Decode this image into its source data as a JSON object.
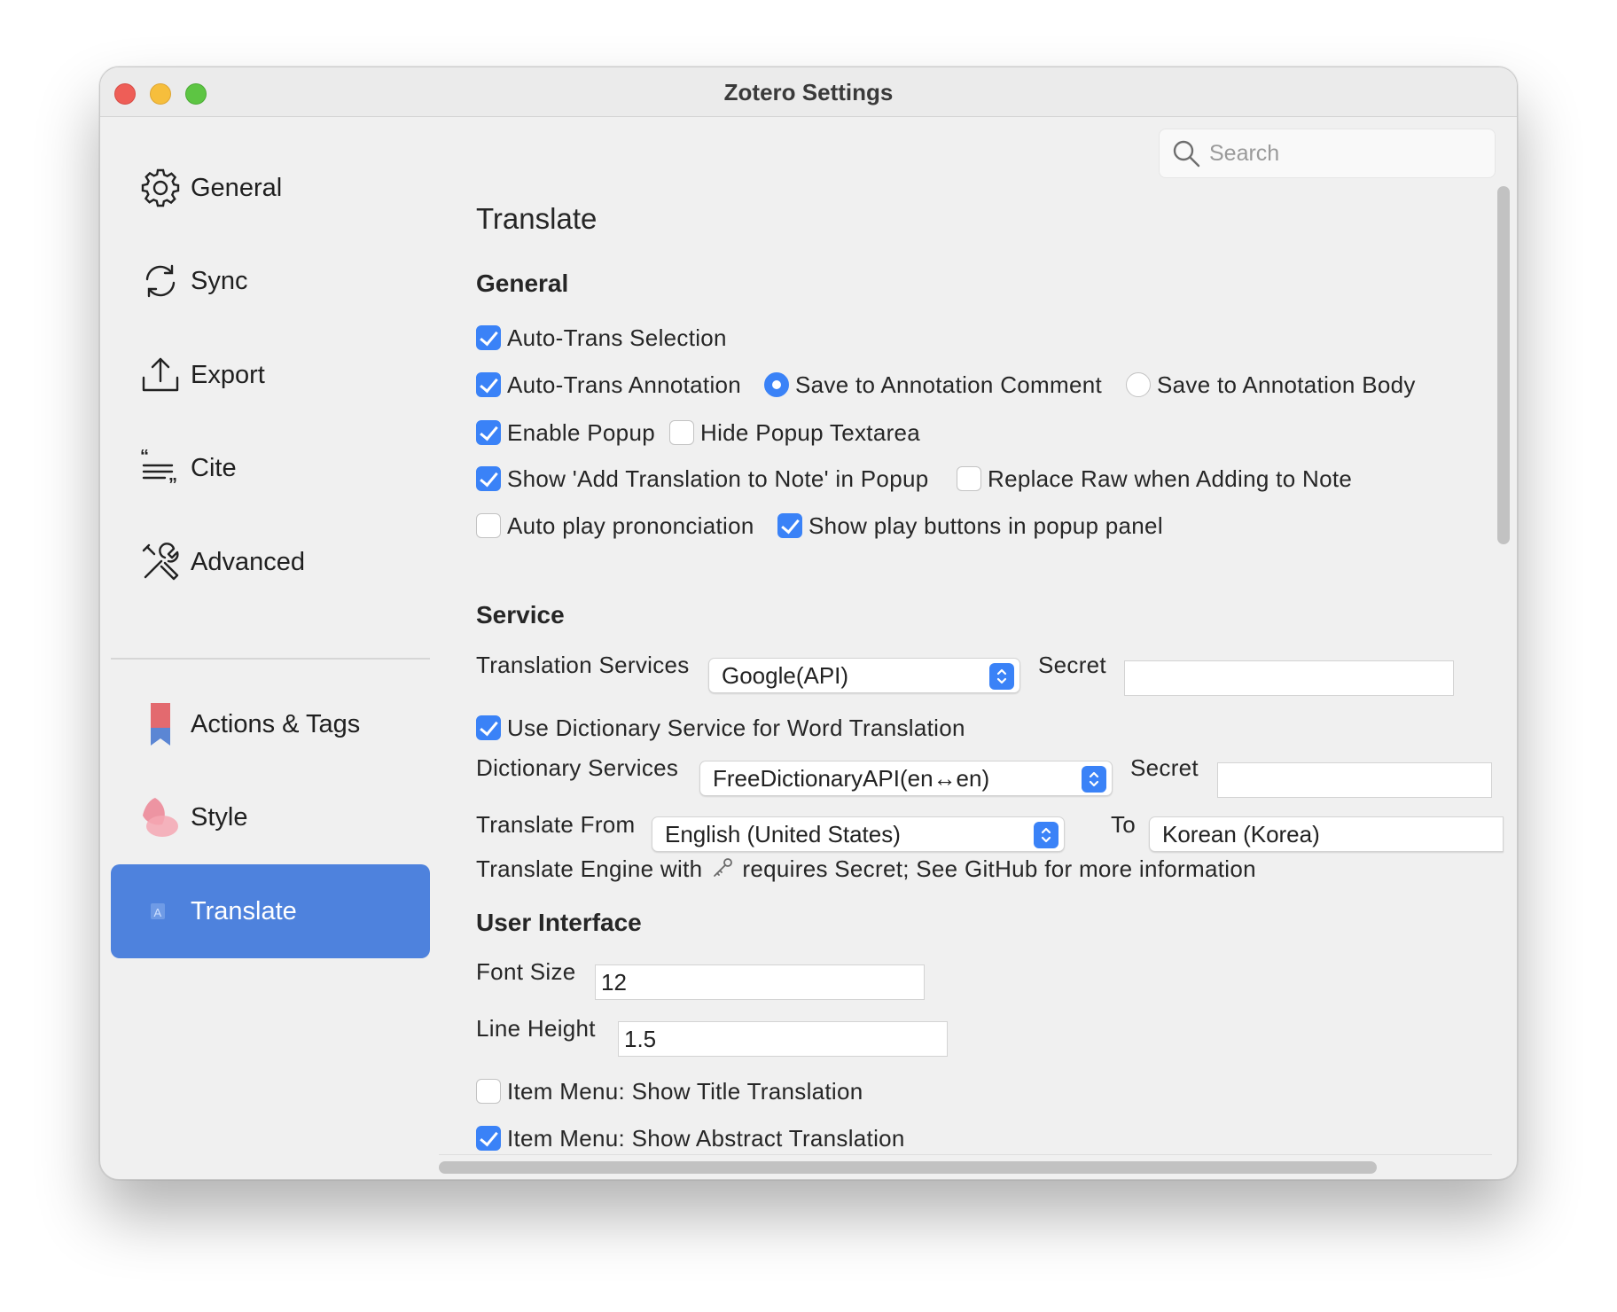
{
  "window": {
    "title": "Zotero Settings"
  },
  "search": {
    "placeholder": "Search"
  },
  "sidebar": {
    "items": [
      {
        "label": "General",
        "icon": "gear-icon"
      },
      {
        "label": "Sync",
        "icon": "sync-icon"
      },
      {
        "label": "Export",
        "icon": "export-icon"
      },
      {
        "label": "Cite",
        "icon": "cite-icon"
      },
      {
        "label": "Advanced",
        "icon": "advanced-tools-icon"
      },
      {
        "label": "Actions & Tags",
        "icon": "bookmark-icon"
      },
      {
        "label": "Style",
        "icon": "style-petal-icon"
      },
      {
        "label": "Translate",
        "icon": "translate-icon",
        "active": true
      }
    ]
  },
  "pane": {
    "title": "Translate",
    "general": {
      "heading": "General",
      "auto_trans_selection": {
        "label": "Auto-Trans Selection",
        "checked": true
      },
      "auto_trans_annotation": {
        "label": "Auto-Trans Annotation",
        "checked": true
      },
      "save_comment": {
        "label": "Save to Annotation Comment",
        "selected": true
      },
      "save_body": {
        "label": "Save to Annotation Body",
        "selected": false
      },
      "enable_popup": {
        "label": "Enable Popup",
        "checked": true
      },
      "hide_popup_textarea": {
        "label": "Hide Popup Textarea",
        "checked": false
      },
      "show_add_translation": {
        "label": "Show 'Add Translation to Note' in Popup",
        "checked": true
      },
      "replace_raw": {
        "label": "Replace Raw when Adding to Note",
        "checked": false
      },
      "auto_play": {
        "label": "Auto play prononciation",
        "checked": false
      },
      "show_play_buttons": {
        "label": "Show play buttons in popup panel",
        "checked": true
      }
    },
    "service": {
      "heading": "Service",
      "translation_services_label": "Translation Services",
      "translation_services_value": "Google(API)",
      "secret_label": "Secret",
      "secret_value": "",
      "use_dictionary": {
        "label": "Use Dictionary Service for Word Translation",
        "checked": true
      },
      "dictionary_services_label": "Dictionary Services",
      "dictionary_services_value": "FreeDictionaryAPI(en↔en)",
      "dict_secret_label": "Secret",
      "dict_secret_value": "",
      "translate_from_label": "Translate From",
      "translate_from_value": "English (United States)",
      "to_label": "To",
      "to_value": "Korean (Korea)",
      "engine_note_prefix": "Translate Engine with",
      "engine_note_suffix": "requires Secret; See GitHub for more information"
    },
    "ui": {
      "heading": "User Interface",
      "font_size_label": "Font Size",
      "font_size_value": "12",
      "line_height_label": "Line Height",
      "line_height_value": "1.5",
      "item_menu_title": {
        "label": "Item Menu: Show Title Translation",
        "checked": false
      },
      "item_menu_abstract": {
        "label": "Item Menu: Show Abstract Translation",
        "checked": true
      }
    }
  },
  "colors": {
    "accent": "#3a82f7",
    "sidebar_active": "#4e82dd"
  }
}
